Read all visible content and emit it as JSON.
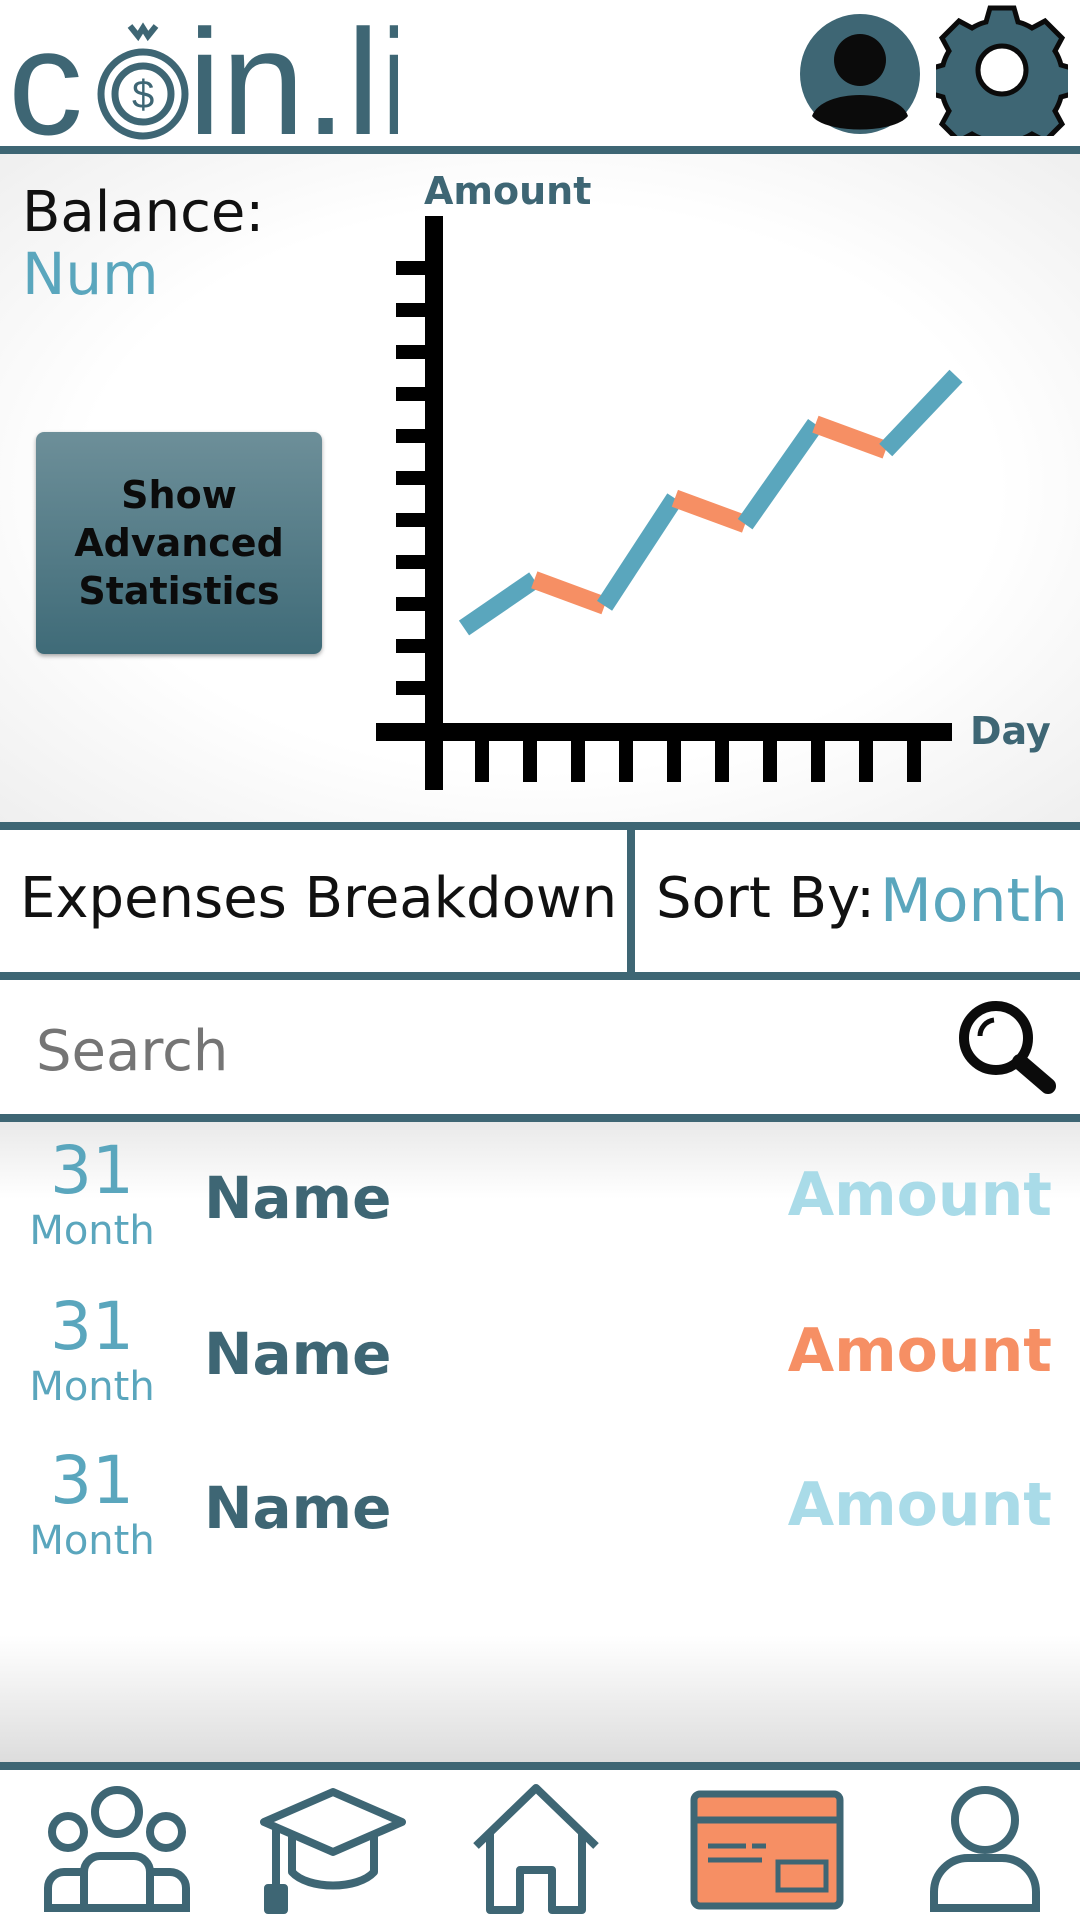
{
  "app": {
    "logo_text_pre": "c",
    "logo_text_post": "in.li",
    "accent": "#3e6674",
    "accent_light": "#5aa6bd",
    "highlight": "#f68f64"
  },
  "header": {
    "profile_icon": "profile-icon",
    "settings_icon": "gear-icon"
  },
  "balance": {
    "label": "Balance:",
    "value": "Num"
  },
  "stats_button": {
    "line1": "Show",
    "line2": "Advanced",
    "line3": "Statistics"
  },
  "chart_data": {
    "type": "line",
    "title": "",
    "ylabel": "Amount",
    "xlabel": "Day",
    "series": [
      {
        "values": [
          1,
          2.3,
          1.6,
          4.5,
          3.8,
          6.5,
          5.8,
          7.8
        ]
      }
    ],
    "up_color": "#5aa6bd",
    "down_color": "#f68f64",
    "grid": false
  },
  "breakdown": {
    "title": "Expenses Breakdown",
    "sort_label": "Sort By:",
    "sort_value": "Month"
  },
  "search": {
    "placeholder": "Search",
    "icon": "search-icon"
  },
  "transactions": [
    {
      "day": "31",
      "month": "Month",
      "name": "Name",
      "amount": "Amount",
      "amount_color": "#a9dbe8"
    },
    {
      "day": "31",
      "month": "Month",
      "name": "Name",
      "amount": "Amount",
      "amount_color": "#f68f64"
    },
    {
      "day": "31",
      "month": "Month",
      "name": "Name",
      "amount": "Amount",
      "amount_color": "#a9dbe8"
    }
  ],
  "nav": {
    "items": [
      "group-icon",
      "graduation-cap-icon",
      "home-icon",
      "credit-card-icon",
      "user-icon"
    ],
    "active": "credit-card-icon"
  }
}
